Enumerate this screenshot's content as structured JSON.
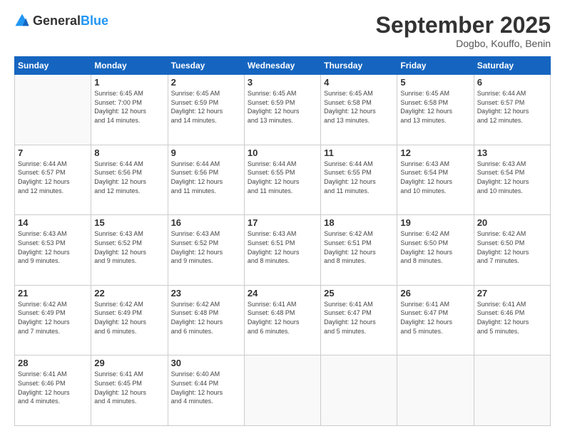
{
  "header": {
    "logo": {
      "general": "General",
      "blue": "Blue"
    },
    "title": "September 2025",
    "location": "Dogbo, Kouffo, Benin"
  },
  "weekdays": [
    "Sunday",
    "Monday",
    "Tuesday",
    "Wednesday",
    "Thursday",
    "Friday",
    "Saturday"
  ],
  "weeks": [
    [
      {
        "day": "",
        "info": ""
      },
      {
        "day": "1",
        "info": "Sunrise: 6:45 AM\nSunset: 7:00 PM\nDaylight: 12 hours\nand 14 minutes."
      },
      {
        "day": "2",
        "info": "Sunrise: 6:45 AM\nSunset: 6:59 PM\nDaylight: 12 hours\nand 14 minutes."
      },
      {
        "day": "3",
        "info": "Sunrise: 6:45 AM\nSunset: 6:59 PM\nDaylight: 12 hours\nand 13 minutes."
      },
      {
        "day": "4",
        "info": "Sunrise: 6:45 AM\nSunset: 6:58 PM\nDaylight: 12 hours\nand 13 minutes."
      },
      {
        "day": "5",
        "info": "Sunrise: 6:45 AM\nSunset: 6:58 PM\nDaylight: 12 hours\nand 13 minutes."
      },
      {
        "day": "6",
        "info": "Sunrise: 6:44 AM\nSunset: 6:57 PM\nDaylight: 12 hours\nand 12 minutes."
      }
    ],
    [
      {
        "day": "7",
        "info": "Sunrise: 6:44 AM\nSunset: 6:57 PM\nDaylight: 12 hours\nand 12 minutes."
      },
      {
        "day": "8",
        "info": "Sunrise: 6:44 AM\nSunset: 6:56 PM\nDaylight: 12 hours\nand 12 minutes."
      },
      {
        "day": "9",
        "info": "Sunrise: 6:44 AM\nSunset: 6:56 PM\nDaylight: 12 hours\nand 11 minutes."
      },
      {
        "day": "10",
        "info": "Sunrise: 6:44 AM\nSunset: 6:55 PM\nDaylight: 12 hours\nand 11 minutes."
      },
      {
        "day": "11",
        "info": "Sunrise: 6:44 AM\nSunset: 6:55 PM\nDaylight: 12 hours\nand 11 minutes."
      },
      {
        "day": "12",
        "info": "Sunrise: 6:43 AM\nSunset: 6:54 PM\nDaylight: 12 hours\nand 10 minutes."
      },
      {
        "day": "13",
        "info": "Sunrise: 6:43 AM\nSunset: 6:54 PM\nDaylight: 12 hours\nand 10 minutes."
      }
    ],
    [
      {
        "day": "14",
        "info": "Sunrise: 6:43 AM\nSunset: 6:53 PM\nDaylight: 12 hours\nand 9 minutes."
      },
      {
        "day": "15",
        "info": "Sunrise: 6:43 AM\nSunset: 6:52 PM\nDaylight: 12 hours\nand 9 minutes."
      },
      {
        "day": "16",
        "info": "Sunrise: 6:43 AM\nSunset: 6:52 PM\nDaylight: 12 hours\nand 9 minutes."
      },
      {
        "day": "17",
        "info": "Sunrise: 6:43 AM\nSunset: 6:51 PM\nDaylight: 12 hours\nand 8 minutes."
      },
      {
        "day": "18",
        "info": "Sunrise: 6:42 AM\nSunset: 6:51 PM\nDaylight: 12 hours\nand 8 minutes."
      },
      {
        "day": "19",
        "info": "Sunrise: 6:42 AM\nSunset: 6:50 PM\nDaylight: 12 hours\nand 8 minutes."
      },
      {
        "day": "20",
        "info": "Sunrise: 6:42 AM\nSunset: 6:50 PM\nDaylight: 12 hours\nand 7 minutes."
      }
    ],
    [
      {
        "day": "21",
        "info": "Sunrise: 6:42 AM\nSunset: 6:49 PM\nDaylight: 12 hours\nand 7 minutes."
      },
      {
        "day": "22",
        "info": "Sunrise: 6:42 AM\nSunset: 6:49 PM\nDaylight: 12 hours\nand 6 minutes."
      },
      {
        "day": "23",
        "info": "Sunrise: 6:42 AM\nSunset: 6:48 PM\nDaylight: 12 hours\nand 6 minutes."
      },
      {
        "day": "24",
        "info": "Sunrise: 6:41 AM\nSunset: 6:48 PM\nDaylight: 12 hours\nand 6 minutes."
      },
      {
        "day": "25",
        "info": "Sunrise: 6:41 AM\nSunset: 6:47 PM\nDaylight: 12 hours\nand 5 minutes."
      },
      {
        "day": "26",
        "info": "Sunrise: 6:41 AM\nSunset: 6:47 PM\nDaylight: 12 hours\nand 5 minutes."
      },
      {
        "day": "27",
        "info": "Sunrise: 6:41 AM\nSunset: 6:46 PM\nDaylight: 12 hours\nand 5 minutes."
      }
    ],
    [
      {
        "day": "28",
        "info": "Sunrise: 6:41 AM\nSunset: 6:46 PM\nDaylight: 12 hours\nand 4 minutes."
      },
      {
        "day": "29",
        "info": "Sunrise: 6:41 AM\nSunset: 6:45 PM\nDaylight: 12 hours\nand 4 minutes."
      },
      {
        "day": "30",
        "info": "Sunrise: 6:40 AM\nSunset: 6:44 PM\nDaylight: 12 hours\nand 4 minutes."
      },
      {
        "day": "",
        "info": ""
      },
      {
        "day": "",
        "info": ""
      },
      {
        "day": "",
        "info": ""
      },
      {
        "day": "",
        "info": ""
      }
    ]
  ]
}
